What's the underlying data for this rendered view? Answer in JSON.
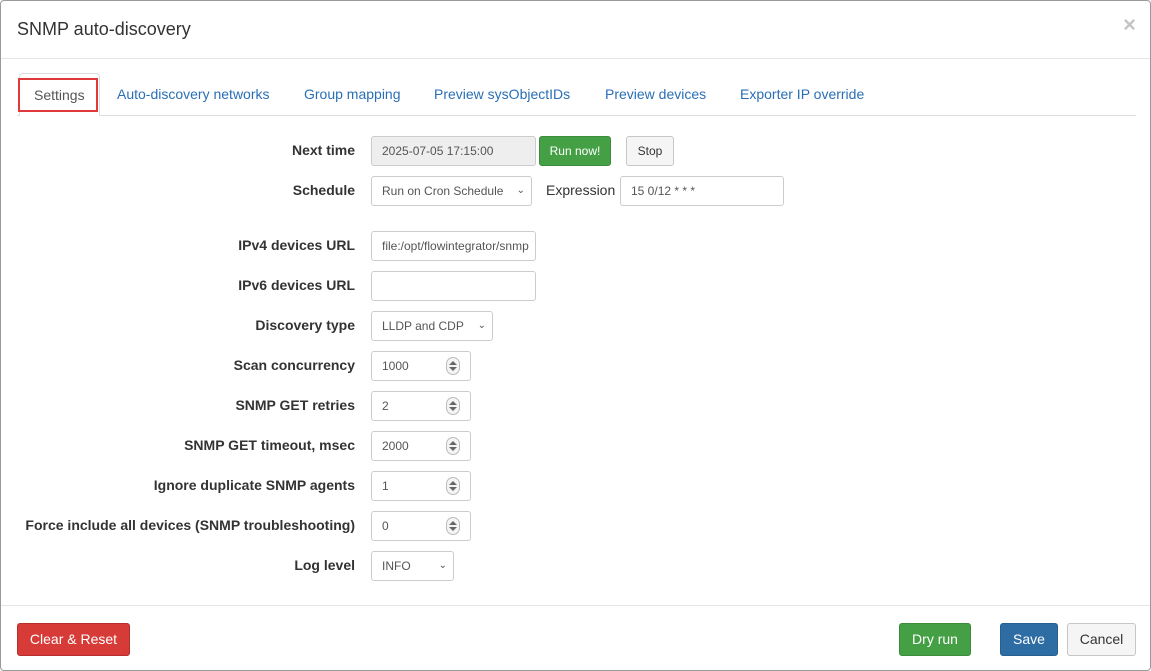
{
  "dialog": {
    "title": "SNMP auto-discovery",
    "close_label": "×"
  },
  "tabs": [
    {
      "label": "Settings",
      "active": true
    },
    {
      "label": "Auto-discovery networks"
    },
    {
      "label": "Group mapping"
    },
    {
      "label": "Preview sysObjectIDs"
    },
    {
      "label": "Preview devices"
    },
    {
      "label": "Exporter IP override"
    }
  ],
  "form": {
    "next_time": {
      "label": "Next time",
      "value": "2025-07-05 17:15:00",
      "run_now_label": "Run now!",
      "stop_label": "Stop"
    },
    "schedule": {
      "label": "Schedule",
      "value": "Run on Cron Schedule",
      "expression_label": "Expression",
      "expression_value": "15 0/12 * * *"
    },
    "ipv4_url": {
      "label": "IPv4 devices URL",
      "value": "file:/opt/flowintegrator/snmp"
    },
    "ipv6_url": {
      "label": "IPv6 devices URL",
      "value": ""
    },
    "discovery_type": {
      "label": "Discovery type",
      "value": "LLDP and CDP"
    },
    "scan_concurrency": {
      "label": "Scan concurrency",
      "value": "1000"
    },
    "snmp_get_retries": {
      "label": "SNMP GET retries",
      "value": "2"
    },
    "snmp_get_timeout": {
      "label": "SNMP GET timeout, msec",
      "value": "2000"
    },
    "ignore_duplicate": {
      "label": "Ignore duplicate SNMP agents",
      "value": "1"
    },
    "force_include": {
      "label": "Force include all devices (SNMP troubleshooting)",
      "value": "0"
    },
    "log_level": {
      "label": "Log level",
      "value": "INFO"
    }
  },
  "footer": {
    "clear_reset_label": "Clear & Reset",
    "dry_run_label": "Dry run",
    "save_label": "Save",
    "cancel_label": "Cancel"
  },
  "colors": {
    "link": "#2a6fb5",
    "success": "#45a045",
    "danger": "#d63b38",
    "primary": "#2e6da4",
    "highlight": "#e0393c"
  },
  "icons": {
    "close": "close-icon",
    "select": "chevron-down-icon",
    "spinner": "spinner-icon"
  }
}
